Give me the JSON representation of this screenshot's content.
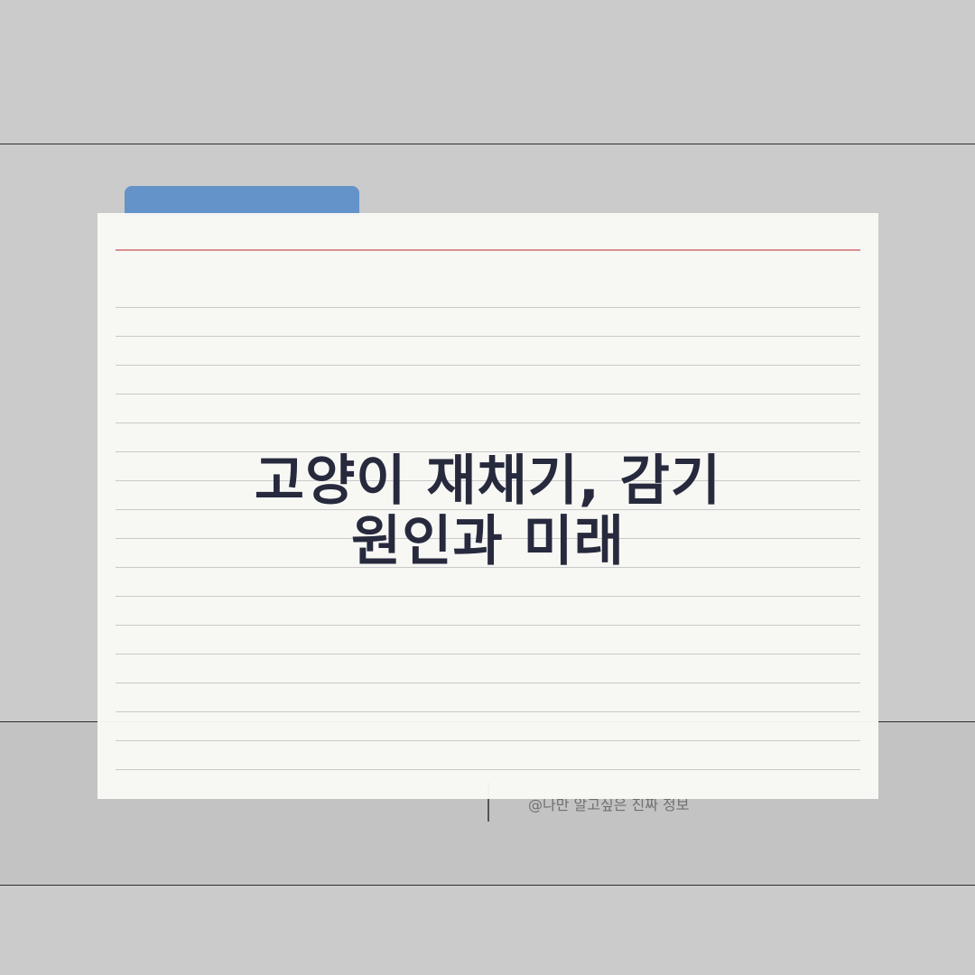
{
  "card": {
    "title_line1": "고양이 재채기, 감기",
    "title_line2": "원인과 미래"
  },
  "footer": {
    "credit": "@나만 알고싶은 진짜 정보"
  },
  "colors": {
    "background": "#cbcbcb",
    "band": "#c3c3c3",
    "folder_tab": "#6393c9",
    "card": "#f9f9f6",
    "margin_line": "#d98f8f",
    "rule_lines": "#c9c9c9",
    "title_text": "#272a3d"
  }
}
